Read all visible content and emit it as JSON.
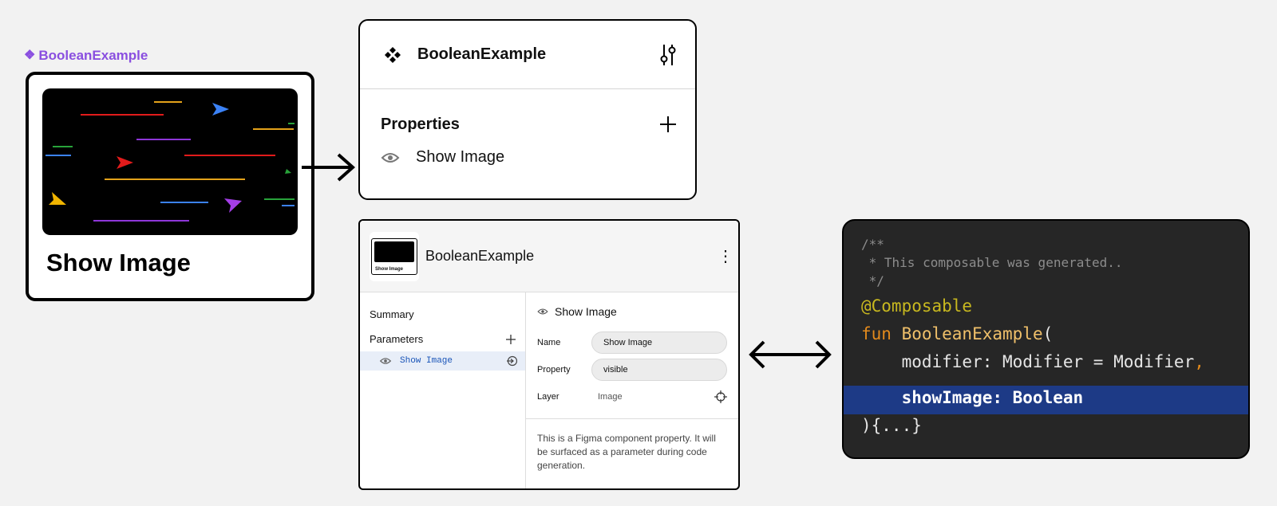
{
  "component": {
    "label": "BooleanExample",
    "caption": "Show Image"
  },
  "properties_panel": {
    "component_name": "BooleanExample",
    "section_title": "Properties",
    "property_label": "Show Image"
  },
  "code_panel": {
    "component_name": "BooleanExample",
    "summary_label": "Summary",
    "parameters_label": "Parameters",
    "parameter_item": "Show Image",
    "detail_title": "Show Image",
    "fields": [
      {
        "key": "Name",
        "value": "Show Image"
      },
      {
        "key": "Property",
        "value": "visible"
      },
      {
        "key": "Layer",
        "value": "Image"
      }
    ],
    "description": "This is a Figma component property. It will be surfaced as a parameter during code generation.",
    "thumbnail_caption": "Show Image"
  },
  "code": {
    "comment_open": "/**",
    "comment_body": " * This composable was generated..",
    "comment_close": " */",
    "annotation": "@Composable",
    "keyword_fun": "fun ",
    "function_name": "BooleanExample",
    "paren_open": "(",
    "param1": "    modifier: Modifier = Modifier",
    "param1_comma": ",",
    "param2": "    showImage: Boolean",
    "closing": "){...}"
  },
  "colors": {
    "accent_purple": "#8a4fe0",
    "highlight_blue": "#1d3a86",
    "code_bg": "#262626"
  }
}
